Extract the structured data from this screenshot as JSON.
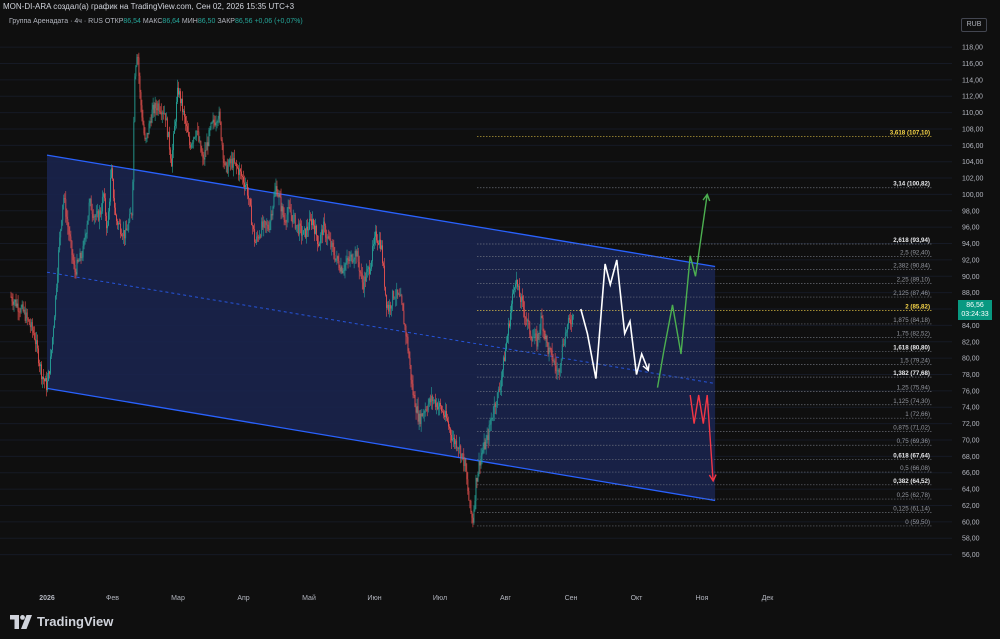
{
  "header": {
    "attribution": "MON-DI-ARA создал(а) график на TradingView.com, Сен 02, 2026 15:35 UTC+3"
  },
  "legend": {
    "symbol": "Группа Аренадата · 4ч · RUS",
    "open_label": "ОТКР",
    "open_value": "86,54",
    "high_label": "МАКС",
    "high_value": "86,64",
    "low_label": "МИН",
    "low_value": "86,50",
    "close_label": "ЗАКР",
    "close_value": "86,56",
    "change": "+0,06 (+0,07%)"
  },
  "currency": "RUB",
  "current_price": {
    "value": "86,56",
    "countdown": "03:24:33"
  },
  "brand": {
    "name": "TradingView"
  },
  "colors": {
    "up": "#26a69a",
    "down": "#ef5350",
    "channel_line": "#2962ff",
    "channel_fill": "#1a2550",
    "fib_line": "#787b86",
    "fib_highlight": "#f7d549",
    "white_path": "#ffffff",
    "green_path": "#4caf50",
    "red_path": "#f23645"
  },
  "chart_data": {
    "type": "candlestick",
    "y_axis": {
      "min": 56,
      "max": 120,
      "ticks": [
        "118,00",
        "116,00",
        "114,00",
        "112,00",
        "110,00",
        "108,00",
        "106,00",
        "104,00",
        "102,00",
        "100,00",
        "98,00",
        "96,00",
        "94,00",
        "92,00",
        "90,00",
        "88,00",
        "86,00",
        "84,00",
        "82,00",
        "80,00",
        "78,00",
        "76,00",
        "74,00",
        "72,00",
        "70,00",
        "68,00",
        "66,00",
        "64,00",
        "62,00",
        "60,00",
        "58,00",
        "56,00"
      ]
    },
    "x_axis": {
      "labels": [
        {
          "text": "2026",
          "month": 0
        },
        {
          "text": "Фев",
          "month": 1
        },
        {
          "text": "Мар",
          "month": 2
        },
        {
          "text": "Апр",
          "month": 3
        },
        {
          "text": "Май",
          "month": 4
        },
        {
          "text": "Июн",
          "month": 5
        },
        {
          "text": "Июл",
          "month": 6
        },
        {
          "text": "Авг",
          "month": 7
        },
        {
          "text": "Сен",
          "month": 8
        },
        {
          "text": "Окт",
          "month": 9
        },
        {
          "text": "Ноя",
          "month": 10
        },
        {
          "text": "Дек",
          "month": 11
        }
      ]
    },
    "close_path": [
      [
        -0.55,
        87.5
      ],
      [
        -0.45,
        86.5
      ],
      [
        -0.35,
        85.5
      ],
      [
        -0.2,
        83
      ],
      [
        -0.08,
        78
      ],
      [
        0,
        76.5
      ],
      [
        0.06,
        80
      ],
      [
        0.12,
        86
      ],
      [
        0.18,
        93
      ],
      [
        0.25,
        100
      ],
      [
        0.32,
        96
      ],
      [
        0.42,
        90.5
      ],
      [
        0.55,
        93
      ],
      [
        0.65,
        99
      ],
      [
        0.75,
        97
      ],
      [
        0.82,
        98
      ],
      [
        0.86,
        100
      ],
      [
        0.92,
        95.5
      ],
      [
        0.98,
        103
      ],
      [
        1.05,
        97
      ],
      [
        1.12,
        96
      ],
      [
        1.2,
        95
      ],
      [
        1.3,
        98
      ],
      [
        1.34,
        115
      ],
      [
        1.38,
        118
      ],
      [
        1.42,
        112
      ],
      [
        1.5,
        106
      ],
      [
        1.6,
        110
      ],
      [
        1.7,
        111
      ],
      [
        1.8,
        110
      ],
      [
        1.9,
        104
      ],
      [
        2.0,
        113
      ],
      [
        2.08,
        110
      ],
      [
        2.18,
        106
      ],
      [
        2.28,
        108
      ],
      [
        2.38,
        104
      ],
      [
        2.5,
        108
      ],
      [
        2.62,
        110
      ],
      [
        2.72,
        103
      ],
      [
        2.82,
        104
      ],
      [
        2.92,
        103
      ],
      [
        3.05,
        101
      ],
      [
        3.18,
        94
      ],
      [
        3.28,
        96
      ],
      [
        3.38,
        96
      ],
      [
        3.5,
        101
      ],
      [
        3.62,
        97
      ],
      [
        3.7,
        98
      ],
      [
        3.82,
        96
      ],
      [
        3.92,
        95
      ],
      [
        4.05,
        97
      ],
      [
        4.15,
        94
      ],
      [
        4.22,
        96
      ],
      [
        4.32,
        94
      ],
      [
        4.42,
        92
      ],
      [
        4.5,
        91
      ],
      [
        4.62,
        92
      ],
      [
        4.72,
        93
      ],
      [
        4.82,
        89
      ],
      [
        4.92,
        91
      ],
      [
        5.02,
        95
      ],
      [
        5.1,
        94
      ],
      [
        5.18,
        87
      ],
      [
        5.22,
        86
      ],
      [
        5.3,
        88
      ],
      [
        5.4,
        87
      ],
      [
        5.5,
        82
      ],
      [
        5.58,
        76
      ],
      [
        5.68,
        72.5
      ],
      [
        5.78,
        74
      ],
      [
        5.88,
        75
      ],
      [
        6.0,
        74
      ],
      [
        6.1,
        72.5
      ],
      [
        6.2,
        70
      ],
      [
        6.28,
        69.5
      ],
      [
        6.38,
        67
      ],
      [
        6.45,
        62
      ],
      [
        6.5,
        60
      ],
      [
        6.55,
        65
      ],
      [
        6.62,
        68
      ],
      [
        6.72,
        70
      ],
      [
        6.82,
        74
      ],
      [
        6.9,
        76
      ],
      [
        6.98,
        80
      ],
      [
        7.05,
        84
      ],
      [
        7.1,
        87
      ],
      [
        7.15,
        90
      ],
      [
        7.2,
        88
      ],
      [
        7.28,
        86
      ],
      [
        7.38,
        83
      ],
      [
        7.48,
        82
      ],
      [
        7.55,
        85
      ],
      [
        7.65,
        81
      ],
      [
        7.72,
        80
      ],
      [
        7.8,
        78
      ],
      [
        7.88,
        82
      ],
      [
        7.95,
        84
      ],
      [
        8.02,
        85
      ],
      [
        8.05,
        86.56
      ]
    ],
    "channel": {
      "upper": [
        [
          0,
          104.8
        ],
        [
          10.2,
          91.2
        ]
      ],
      "lower": [
        [
          0,
          76.3
        ],
        [
          10.2,
          62.6
        ]
      ],
      "mid": [
        [
          0,
          90.5
        ],
        [
          10.2,
          76.9
        ]
      ]
    },
    "fibonacci": [
      {
        "label": "3,618 (107,10)",
        "value": 107.1,
        "highlight": true
      },
      {
        "label": "3,14 (100,82)",
        "value": 100.82,
        "bold": true
      },
      {
        "label": "2,618 (93,94)",
        "value": 93.94,
        "bold": true
      },
      {
        "label": "2,5 (92,40)",
        "value": 92.4
      },
      {
        "label": "2,382 (90,84)",
        "value": 90.84
      },
      {
        "label": "2,25 (89,10)",
        "value": 89.1
      },
      {
        "label": "2,125 (87,46)",
        "value": 87.46
      },
      {
        "label": "2 (85,82)",
        "value": 85.82,
        "highlight": true
      },
      {
        "label": "1,875 (84,18)",
        "value": 84.18
      },
      {
        "label": "1,75 (82,52)",
        "value": 82.52
      },
      {
        "label": "1,618 (80,80)",
        "value": 80.8,
        "bold": true
      },
      {
        "label": "1,5 (79,24)",
        "value": 79.24
      },
      {
        "label": "1,382 (77,68)",
        "value": 77.68,
        "bold": true
      },
      {
        "label": "1,25 (75,94)",
        "value": 75.94
      },
      {
        "label": "1,125 (74,30)",
        "value": 74.3
      },
      {
        "label": "1 (72,66)",
        "value": 72.66
      },
      {
        "label": "0,875 (71,02)",
        "value": 71.02
      },
      {
        "label": "0,75 (69,36)",
        "value": 69.36
      },
      {
        "label": "0,618 (67,64)",
        "value": 67.64,
        "bold": true
      },
      {
        "label": "0,5 (66,08)",
        "value": 66.08
      },
      {
        "label": "0,382 (64,52)",
        "value": 64.52,
        "bold": true
      },
      {
        "label": "0,25 (62,78)",
        "value": 62.78
      },
      {
        "label": "0,125 (61,14)",
        "value": 61.14
      },
      {
        "label": "0 (59,50)",
        "value": 59.5
      }
    ],
    "projections": {
      "white": [
        [
          8.15,
          86
        ],
        [
          8.25,
          83
        ],
        [
          8.38,
          77.5
        ],
        [
          8.52,
          91.5
        ],
        [
          8.6,
          89
        ],
        [
          8.7,
          92
        ],
        [
          8.82,
          83
        ],
        [
          8.9,
          84.5
        ],
        [
          9.0,
          78
        ],
        [
          9.08,
          80.5
        ],
        [
          9.18,
          78.5
        ]
      ],
      "white_arrow_tip": [
        9.18,
        78.5
      ],
      "green": [
        [
          9.32,
          76.4
        ],
        [
          9.42,
          81
        ],
        [
          9.55,
          86.5
        ],
        [
          9.68,
          80.5
        ],
        [
          9.82,
          92.5
        ],
        [
          9.9,
          90
        ],
        [
          10.08,
          100
        ]
      ],
      "green_arrow_tip": [
        10.08,
        100
      ],
      "red": [
        [
          9.82,
          75.5
        ],
        [
          9.88,
          72
        ],
        [
          9.95,
          75.5
        ],
        [
          10.02,
          72
        ],
        [
          10.08,
          75.5
        ],
        [
          10.17,
          65
        ]
      ],
      "red_arrow_tip": [
        10.17,
        65
      ]
    }
  }
}
